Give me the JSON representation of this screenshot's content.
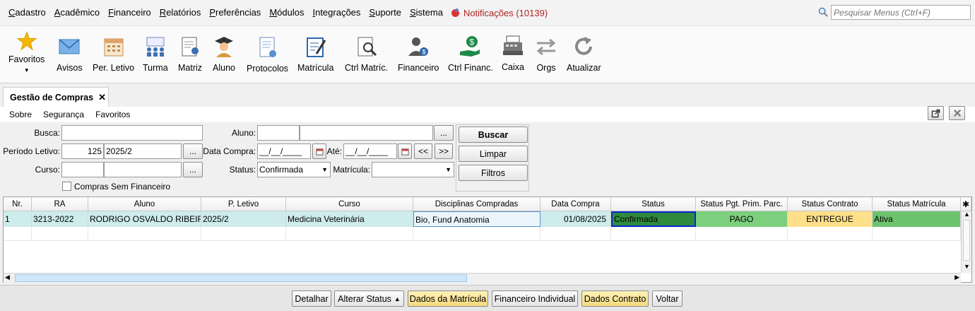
{
  "menu": {
    "items": [
      "Cadastro",
      "Acadêmico",
      "Financeiro",
      "Relatórios",
      "Preferências",
      "Módulos",
      "Integrações",
      "Suporte",
      "Sistema"
    ],
    "notifications": "Notificações (10139)",
    "search_placeholder": "Pesquisar Menus (Ctrl+F)"
  },
  "toolbar": {
    "favoritos": "Favoritos",
    "avisos": "Avisos",
    "per_letivo": "Per. Letivo",
    "turma": "Turma",
    "matriz": "Matriz",
    "aluno": "Aluno",
    "protocolos": "Protocolos",
    "matricula": "Matrícula",
    "ctrl_matric": "Ctrl Matríc.",
    "financeiro": "Financeiro",
    "ctrl_financ": "Ctrl Financ.",
    "caixa": "Caixa",
    "orgs": "Orgs",
    "atualizar": "Atualizar"
  },
  "tab": {
    "title": "Gestão de Compras",
    "close": "✕"
  },
  "submenu": {
    "sobre": "Sobre",
    "seguranca": "Segurança",
    "favoritos": "Favoritos"
  },
  "form": {
    "busca_label": "Busca:",
    "busca_value": "",
    "periodo_label": "Período Letivo:",
    "periodo_code": "125",
    "periodo_value": "2025/2",
    "curso_label": "Curso:",
    "curso_code": "",
    "curso_value": "",
    "compras_sem_financeiro": "Compras Sem Financeiro",
    "aluno_label": "Aluno:",
    "aluno_code": "",
    "aluno_value": "",
    "data_compra_label": "Data Compra:",
    "data_de": "__/__/____",
    "ate_label": "Até:",
    "data_ate": "__/__/____",
    "status_label": "Status:",
    "status_value": "Confirmada",
    "matricula_label": "Matrícula:",
    "matricula_value": "",
    "ellipsis": "...",
    "prev": "<<",
    "next": ">>",
    "buscar": "Buscar",
    "limpar": "Limpar",
    "filtros": "Filtros"
  },
  "grid": {
    "headers": [
      "Nr.",
      "RA",
      "Aluno",
      "P. Letivo",
      "Curso",
      "Disciplinas Compradas",
      "Data Compra",
      "Status",
      "Status Pgt. Prim. Parc.",
      "Status Contrato",
      "Status Matrícula"
    ],
    "rows": [
      [
        "1",
        "3213-2022",
        "RODRIGO OSVALDO RIBEIRO",
        "2025/2",
        "Medicina Veterinária",
        "Bio, Fund Anatomia",
        "01/08/2025",
        "Confirmada",
        "PAGO",
        "ENTREGUE",
        "Ativa"
      ]
    ]
  },
  "footer": {
    "detalhar": "Detalhar",
    "alterar_status": "Alterar Status",
    "dados_matricula": "Dados da Matrícula",
    "financeiro_individual": "Financeiro Individual",
    "dados_contrato": "Dados Contrato",
    "voltar": "Voltar"
  },
  "colors": {
    "status_confirmada": "#2e8b3e",
    "pago": "#7ccf7c",
    "entregue": "#ffe08a",
    "ativa": "#6dc36d",
    "row_bg": "#cdeceb"
  }
}
